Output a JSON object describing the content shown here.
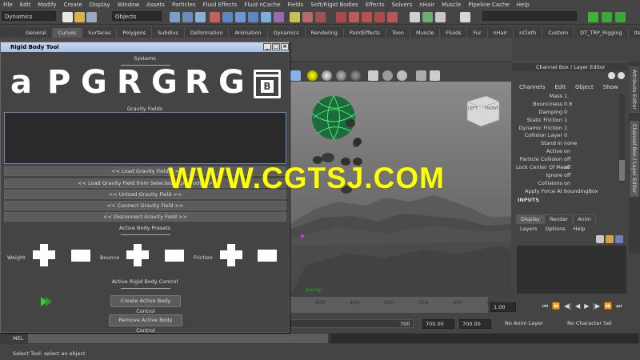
{
  "menus": [
    "File",
    "Edit",
    "Modify",
    "Create",
    "Display",
    "Window",
    "Assets",
    "Particles",
    "Fluid Effects",
    "Fluid nCache",
    "Fields",
    "Soft/Rigid Bodies",
    "Effects",
    "Solvers",
    "nHair",
    "Muscle",
    "Pipeline Cache",
    "Help"
  ],
  "status": {
    "menuset": "Dynamics",
    "selmode": "Objects"
  },
  "shelf_tabs": [
    "General",
    "Curves",
    "Surfaces",
    "Polygons",
    "Subdivs",
    "Deformation",
    "Animation",
    "Dynamics",
    "Rendering",
    "PaintEffects",
    "Toon",
    "Muscle",
    "Fluids",
    "Fur",
    "nHair",
    "nCloth",
    "Custom",
    "DT_TRP_Rigging",
    "Item"
  ],
  "shelf_active": "Curves",
  "tool": {
    "title": "Rigid Body Tool",
    "systems_label": "Systems",
    "glyphs": [
      "a",
      "P",
      "G",
      "R",
      "G",
      "R",
      "G"
    ],
    "b_icon": "B",
    "gravity_label": "Gravity Fields",
    "buttons": [
      "<< Load Gravity Field >>",
      "<< Load Gravity Field from Selected Rigid Body >>",
      "<< Unload Gravity Field >>",
      "<< Connect Gravity Field >>",
      "<< Disconnect Gravity Field >>"
    ],
    "presets_label": "Active Body Presets",
    "weight": "Weight",
    "bounce": "Bounce",
    "friction": "Friction",
    "control_label": "Active Rigid Body Control",
    "create_btn": "Create Active Body Control",
    "remove_btn": "Remove Active Body Control"
  },
  "viewport": {
    "camera": "persp",
    "cube_left": "LEFT",
    "cube_front": "FRONT"
  },
  "channel_box": {
    "title": "Channel Box / Layer Editor",
    "menu": [
      "Channels",
      "Edit",
      "Object",
      "Show"
    ],
    "rows": [
      [
        "Mass",
        "1"
      ],
      [
        "Bounciness",
        "0.6"
      ],
      [
        "Damping",
        "0"
      ],
      [
        "Static Friction",
        "1"
      ],
      [
        "Dynamic Friction",
        "1"
      ],
      [
        "Collision Layer",
        "0"
      ],
      [
        "Stand In",
        "none"
      ],
      [
        "Active",
        "on"
      ],
      [
        "Particle Collision",
        "off"
      ],
      [
        "Lock Center Of Mass",
        "off"
      ],
      [
        "Ignore",
        "off"
      ],
      [
        "Collisions",
        "on"
      ],
      [
        "Apply Force At",
        "boundingBox"
      ]
    ],
    "inputs": "INPUTS"
  },
  "layer_editor": {
    "tabs": [
      "Display",
      "Render",
      "Anim"
    ],
    "menu": [
      "Layers",
      "Options",
      "Help"
    ]
  },
  "side_tabs": [
    "Attribute Editor",
    "Channel Box / Layer Editor"
  ],
  "timeline": {
    "ticks": [
      "400",
      "450",
      "500",
      "550",
      "600",
      "650"
    ],
    "current": "1.00"
  },
  "range": {
    "start": "700",
    "end_a": "700.00",
    "end_b": "700.00",
    "anim_layer": "No Anim Layer",
    "char_set": "No Character Set"
  },
  "cmd": {
    "label": "MEL"
  },
  "help": "Select Tool: select an object",
  "watermark": "WWW.CGTSJ.COM"
}
